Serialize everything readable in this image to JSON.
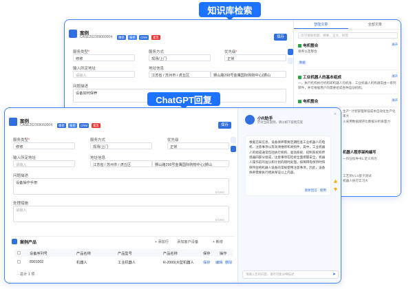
{
  "overlays": {
    "kb_label": "知识库检索",
    "gpt_label": "ChatGPT回复"
  },
  "case": {
    "title": "案例",
    "number": "CASE202309060004",
    "badges": [
      {
        "text": "缴修",
        "color": "#2f6fe0"
      },
      {
        "text": "报修",
        "color": "#3b82f6"
      },
      {
        "text": "CRM",
        "color": "#2f6fe0"
      },
      {
        "text": "紧急",
        "color": "#e33"
      }
    ],
    "save": "保存",
    "fields": {
      "service_type_label": "服务类型",
      "service_type": "修修",
      "service_method_label": "服务方式",
      "service_method": "现场/上门",
      "priority_label": "优先级",
      "priority": "正常",
      "address_label": "输入所定地址",
      "address_ph": "请输入",
      "addr_info_label": "地址信息",
      "region": "江苏省 / 苏州市 / 虎丘区",
      "street": "狮山路298号金鹰国际购物中心(狮山",
      "issue_label": "问题描述",
      "issue_value": "设备如何保养",
      "issue_value2": "设备操作手册",
      "handle_label": "处理措施",
      "handle_ph": "请输入",
      "counter": "0/1000"
    }
  },
  "knowledge": {
    "tab1": "智能文章",
    "tab2": "全部文章",
    "search_ph": "仅可搜索标题、摘要、正文、标签",
    "expand": "展开",
    "items": [
      {
        "title": "电机整合",
        "desc": "保养以及整合",
        "tag": "数据"
      },
      {
        "title": "工业机器人的基本组成",
        "desc": "一、执行机构执行机构即机器人的机身、工业机器人机构通常由一系列转件，并可根据用户的需要组成各种运动机构。",
        "tag": ""
      },
      {
        "title": "电机整合",
        "desc": "",
        "tag": ""
      }
    ],
    "tail_texts": [
      "生产\" 计划管理降低成本自动化生产化率大",
      "火采用数据储存比数据分析质量力",
      "机器人程序架构编写",
      "一作业指导书1.定义作为",
      "工艺到V1.0基于测试",
      "机器人执行实习大"
    ]
  },
  "chat": {
    "bot_name": "小R助手",
    "bot_sub": "针对当前案例，请以如下案例方案",
    "reply": "根据已知信息，设备保养需要定期检查工业机器人的电机、注意事项以及润滑维修和易损件，其中，工业机器人的组成通常包括执行机构、驱动系统、控制系统和传感器四部分组成，注意事项在检修全面把握安全，机器人操作前的准认和计划的随时处理，按障碍等保持时和保持合格机器人设备的常规使用注意事项，因此，设备保养需要执行相关保证以上内容。",
    "regenerate": "重新回答",
    "use": "使用",
    "input_ph": "请输入您的问题，请尽可能详细描述"
  },
  "products": {
    "title": "案例产品",
    "actions": [
      "+ 添加行",
      "添加客户设备",
      "+ 新增"
    ],
    "headers": [
      "设备序列号",
      "产品名称",
      "产品型号",
      "产品名称",
      "保存",
      "操作"
    ],
    "row": [
      "8901002",
      "机器人",
      "工业机器人",
      "R-2000(大型机器人",
      "保存",
      "编辑",
      "删除"
    ],
    "total": "总计 1 项"
  }
}
